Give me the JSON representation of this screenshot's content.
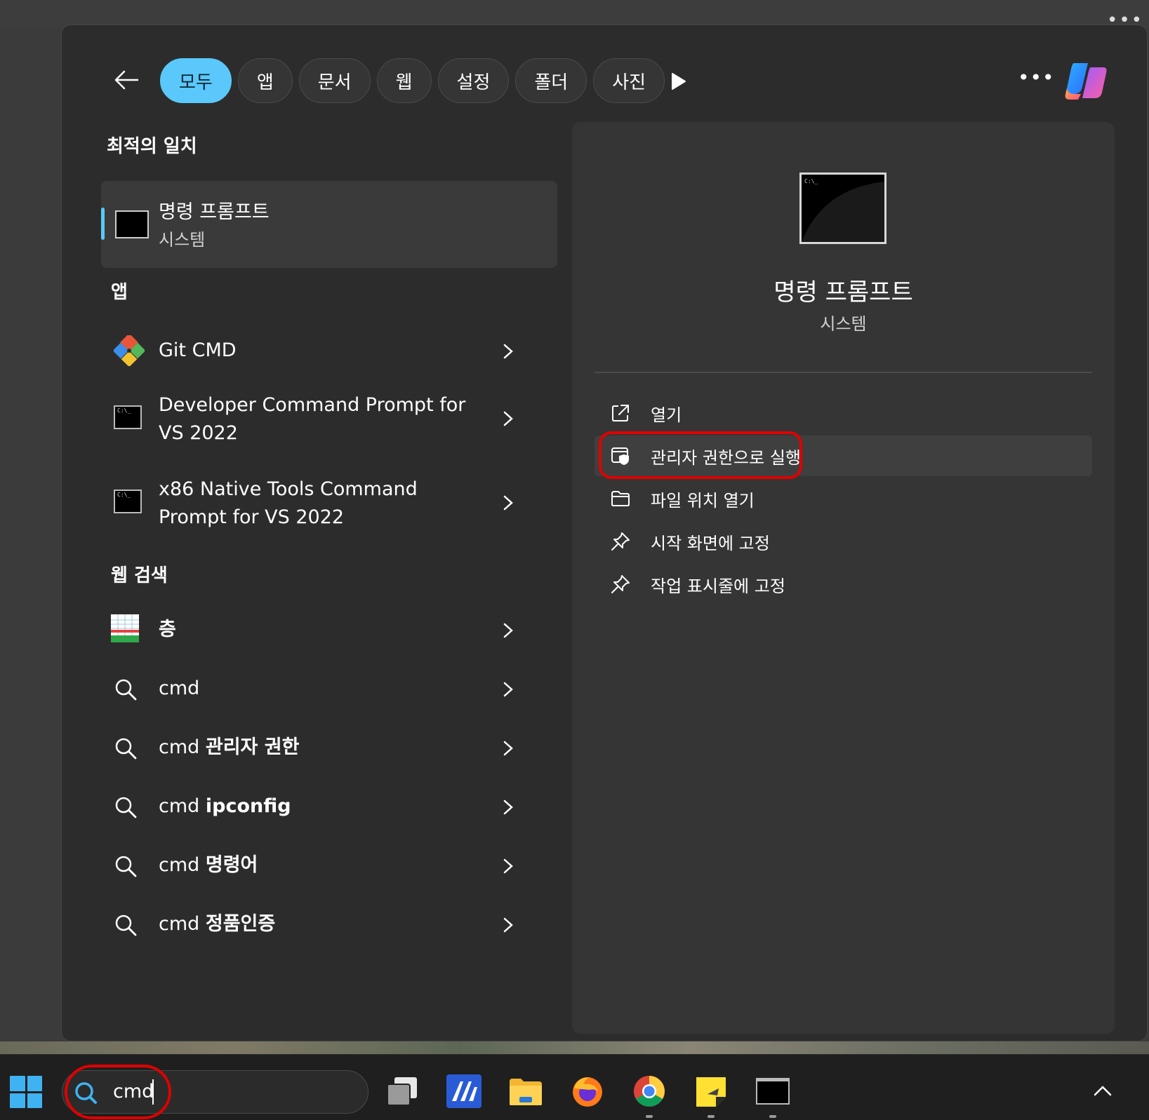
{
  "filters": {
    "chips": [
      "모두",
      "앱",
      "문서",
      "웹",
      "설정",
      "폴더",
      "사진"
    ],
    "active": "모두"
  },
  "colors": {
    "accent": "#5ac8fa",
    "annotation": "#e00000",
    "panel": "#2c2c2c"
  },
  "best_match": {
    "title": "최적의 일치",
    "name": "명령 프롬프트",
    "type": "시스템"
  },
  "apps": {
    "title": "앱",
    "items": [
      {
        "label": "Git CMD",
        "icon": "git-icon"
      },
      {
        "label_line1": "Developer Command Prompt for",
        "label_line2": "VS 2022",
        "icon": "terminal-icon"
      },
      {
        "label_line1": "x86 Native Tools Command",
        "label_line2": "Prompt for VS 2022",
        "icon": "terminal-icon"
      }
    ]
  },
  "web": {
    "title": "웹 검색",
    "items": [
      {
        "prefix": "",
        "bold": "층",
        "icon": "web-result-thumbnail"
      },
      {
        "prefix": "cmd",
        "bold": "",
        "icon": "search-icon"
      },
      {
        "prefix": "cmd ",
        "bold": "관리자 권한",
        "icon": "search-icon"
      },
      {
        "prefix": "cmd ",
        "bold": "ipconfig",
        "icon": "search-icon"
      },
      {
        "prefix": "cmd ",
        "bold": "명령어",
        "icon": "search-icon"
      },
      {
        "prefix": "cmd ",
        "bold": "정품인증",
        "icon": "search-icon"
      }
    ]
  },
  "detail": {
    "name": "명령 프롬프트",
    "type": "시스템",
    "actions": [
      {
        "label": "열기",
        "icon": "open-external-icon"
      },
      {
        "label": "관리자 권한으로 실행",
        "icon": "shield-icon"
      },
      {
        "label": "파일 위치 열기",
        "icon": "folder-icon"
      },
      {
        "label": "시작 화면에 고정",
        "icon": "pin-icon"
      },
      {
        "label": "작업 표시줄에 고정",
        "icon": "pin-icon"
      }
    ]
  },
  "taskbar": {
    "search_text": "cmd"
  }
}
